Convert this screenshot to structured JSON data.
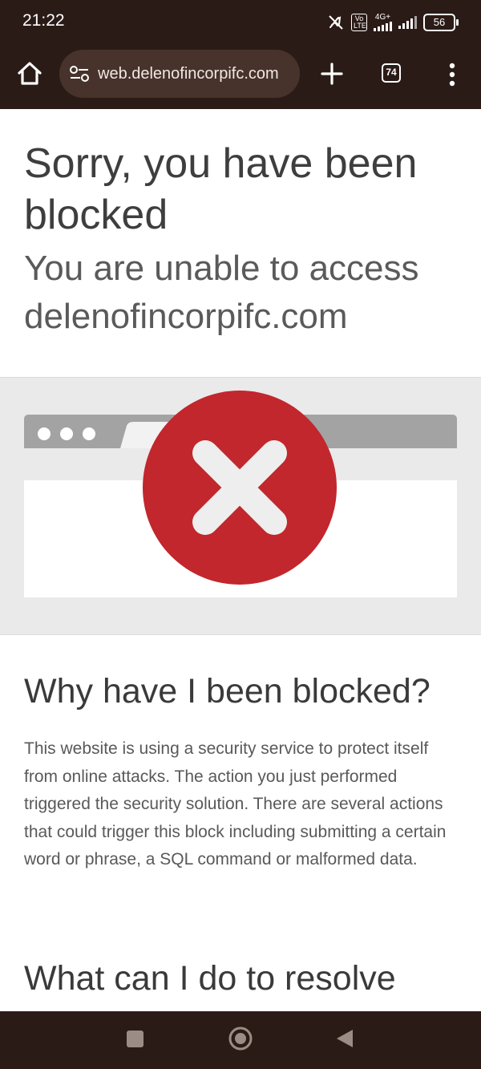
{
  "status_bar": {
    "time": "21:22",
    "volte": "Vo LTE",
    "network": "4G+",
    "battery": "56"
  },
  "browser": {
    "url": "web.delenofincorpifc.com",
    "tab_count": "74",
    "icons": [
      "home-icon",
      "site-settings-icon",
      "new-tab-icon",
      "tab-switcher-icon",
      "more-menu-icon"
    ]
  },
  "page": {
    "title": "Sorry, you have been blocked",
    "subtitle_line1": "You are unable to access",
    "subtitle_line2": "delenofincorpifc.com",
    "why_heading": "Why have I been blocked?",
    "why_text": "This website is using a security service to protect itself from online attacks. The action you just performed triggered the security solution. There are several actions that could trigger this block including submitting a certain word or phrase, a SQL command or malformed data.",
    "resolve_heading": "What can I do to resolve"
  },
  "colors": {
    "toolbar_bg": "#2b1b16",
    "url_pill_bg": "#47332b",
    "block_red": "#c1272d",
    "hero_bg": "#eaeaea"
  },
  "navigation_bar": {
    "icons": [
      "recents-icon",
      "home-circle-icon",
      "back-icon"
    ]
  }
}
